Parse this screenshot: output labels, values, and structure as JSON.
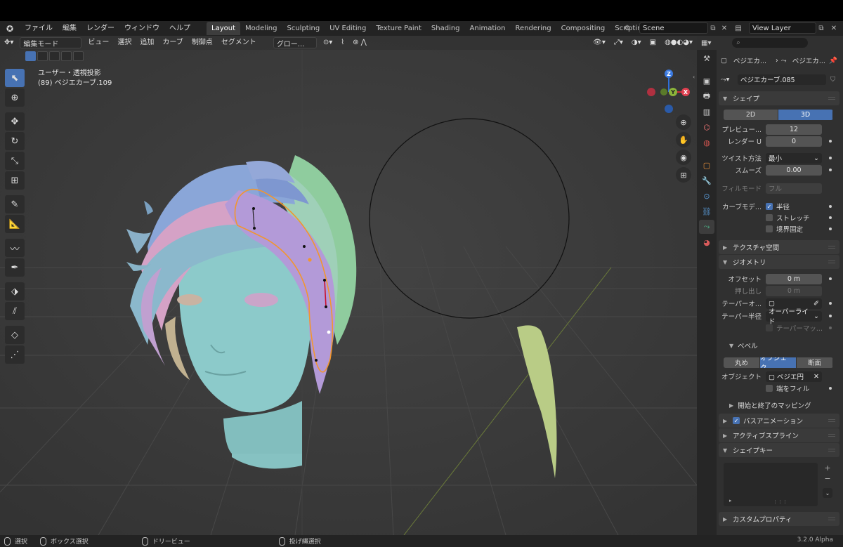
{
  "app": {
    "menu": [
      "ファイル",
      "編集",
      "レンダー",
      "ウィンドウ",
      "ヘルプ"
    ],
    "workspaces": [
      "Layout",
      "Modeling",
      "Sculpting",
      "UV Editing",
      "Texture Paint",
      "Shading",
      "Animation",
      "Rendering",
      "Compositing",
      "Scripting"
    ],
    "active_workspace": "Layout",
    "add_tab": "+",
    "scene": "Scene",
    "view_layer": "View Layer",
    "version": "3.2.0 Alpha"
  },
  "viewport": {
    "mode": "編集モード",
    "header_menus": [
      "ビュー",
      "選択",
      "追加",
      "カーブ",
      "制御点",
      "セグメント"
    ],
    "orientation": "グロー...",
    "view_name": "ユーザー・透視投影",
    "object_line": "(89) ベジエカーブ.109",
    "gizmo": {
      "x": "X",
      "y": "Y",
      "z": "Z"
    }
  },
  "status": {
    "select": "選択",
    "box_select": "ボックス選択",
    "dolly": "ドリービュー",
    "lasso": "投げ縄選択"
  },
  "properties": {
    "breadcrumb_a": "ベジエカ...",
    "breadcrumb_b": "ベジエカ...",
    "data_name": "ベジエカーブ.085",
    "shape": {
      "title": "シェイプ",
      "mode_2d": "2D",
      "mode_3d": "3D",
      "preview_label": "プレビュー...",
      "preview_value": "12",
      "render_label": "レンダー U",
      "render_value": "0",
      "twist_label": "ツイスト方法",
      "twist_value": "最小",
      "smooth_label": "スムーズ",
      "smooth_value": "0.00",
      "fill_label": "フィルモード",
      "fill_value": "フル",
      "curve_deform_label": "カーブモデ...",
      "radius": "半径",
      "stretch": "ストレッチ",
      "bounds_clamp": "境界固定"
    },
    "texture_space": "テクスチャ空間",
    "geometry": {
      "title": "ジオメトリ",
      "offset_label": "オフセット",
      "offset_value": "0 m",
      "extrude_label": "押し出し",
      "extrude_value": "0 m",
      "taper_obj_label": "テーパーオ...",
      "taper_radius_label": "テーパー半径",
      "taper_radius_value": "オーバーライド",
      "taper_map": "テーパーマッ..."
    },
    "bevel": {
      "title": "ベベル",
      "round": "丸め",
      "object": "オブジェク...",
      "profile": "断面",
      "object_label": "オブジェクト",
      "object_value": "ベジエ円",
      "fill_caps": "端をフィル"
    },
    "start_end": "開始と終了のマッピング",
    "path_anim": "パスアニメーション",
    "active_spline": "アクティブスプライン",
    "shape_keys": "シェイプキー",
    "custom_props": "カスタムプロパティ"
  }
}
